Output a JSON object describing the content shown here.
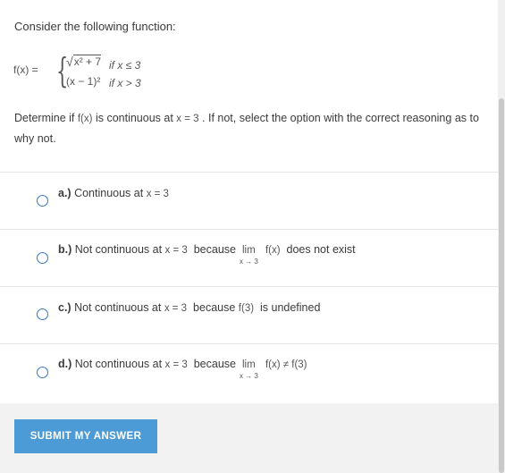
{
  "question": {
    "intro": "Consider the following function:",
    "function": {
      "lhs": "f(x) =",
      "case1_expr": "x² + 7",
      "case1_cond": "if x ≤ 3",
      "case2_expr": "(x − 1)²",
      "case2_cond": "if x > 3"
    },
    "prompt_a": "Determine if ",
    "prompt_fx": "f(x)",
    "prompt_b": " is continuous at ",
    "prompt_x3": "x = 3",
    "prompt_c": " . If not, select the option with the correct reasoning as to why not."
  },
  "options": [
    {
      "letter": "a.)",
      "text": " Continuous at ",
      "math": "x = 3"
    },
    {
      "letter": "b.)",
      "text": " Not continuous at ",
      "math": "x = 3",
      "because": "because",
      "lim": "lim",
      "lim_sub": "x → 3",
      "tail_math": "f(x)",
      "tail_text": "does not exist"
    },
    {
      "letter": "c.)",
      "text": " Not continuous at ",
      "math": "x = 3",
      "because": "because",
      "tail_math": "f(3)",
      "tail_text": "is undefined"
    },
    {
      "letter": "d.)",
      "text": " Not continuous at ",
      "math": "x = 3",
      "because": "because",
      "lim": "lim",
      "lim_sub": "x → 3",
      "tail_math": "f(x) ≠ f(3)"
    }
  ],
  "submit_label": "SUBMIT MY ANSWER",
  "colors": {
    "accent": "#4d9bd6",
    "radio": "#2f7bc5",
    "footer_bg": "#f2f2f2"
  }
}
